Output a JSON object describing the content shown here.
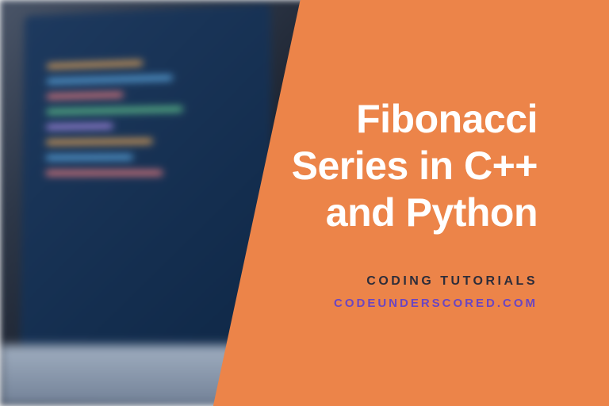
{
  "title": "Fibonacci Series in C++ and Python",
  "category": "CODING TUTORIALS",
  "url": "CODEUNDERSCORED.COM",
  "colors": {
    "accent": "#ec8449",
    "title_text": "#ffffff",
    "category_text": "#2d2d3a",
    "url_text": "#6b46c1"
  }
}
